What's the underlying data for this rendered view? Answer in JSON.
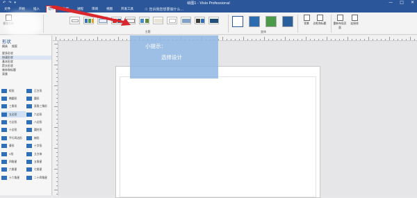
{
  "window": {
    "title": "绘图1 - Visio Professional",
    "qat": [
      "↶",
      "↷",
      "▾"
    ],
    "controls": [
      "—",
      "□",
      "✕"
    ]
  },
  "tabs": [
    {
      "label": "文件",
      "active": false
    },
    {
      "label": "开始",
      "active": false
    },
    {
      "label": "插入",
      "active": false
    },
    {
      "label": "设计",
      "active": true
    },
    {
      "label": "数据",
      "active": false
    },
    {
      "label": "进程",
      "active": false
    },
    {
      "label": "审阅",
      "active": false
    },
    {
      "label": "视图",
      "active": false
    },
    {
      "label": "开发工具",
      "active": false
    }
  ],
  "tellme": "告诉我您想要做什么...",
  "ribbon": {
    "page_setup": {
      "button": "纸张方向"
    },
    "themes_label": "主题",
    "variants_label": "变体",
    "backgrounds": {
      "button1": "背景",
      "button2": "边框和标题"
    },
    "layout": {
      "button1": "重新布局页面",
      "button2": "连接线"
    }
  },
  "shapes_panel": {
    "header": "形状",
    "subtabs": [
      "模具",
      "搜索"
    ],
    "menu": [
      {
        "label": "更多形状",
        "selected": false
      },
      {
        "label": "快速形状",
        "selected": true
      },
      {
        "label": "基本形状",
        "selected": false
      },
      {
        "label": "箭头形状",
        "selected": false
      },
      {
        "label": "装饰和标题",
        "selected": false
      },
      {
        "label": "背景",
        "selected": false
      }
    ],
    "shapes": [
      [
        "矩形",
        "正方形"
      ],
      [
        "椭圆形",
        "圆形"
      ],
      [
        "三角形",
        "直角三角形"
      ],
      [
        "五边形",
        "六边形"
      ],
      [
        "七边形",
        "八边形"
      ],
      [
        "十边形",
        "圆柱形"
      ],
      [
        "平行四边形",
        "梯形"
      ],
      [
        "菱形",
        "十字形"
      ],
      [
        "V形",
        "立方体"
      ],
      [
        "四角星",
        "五角星"
      ],
      [
        "六角星",
        "七角星"
      ],
      [
        "十六角星",
        "二十四角星"
      ]
    ],
    "selected_shape": "五边形"
  },
  "tip": {
    "line1": "小提示：",
    "line2": "选择设计"
  },
  "colors": {
    "accent": "#2b579a",
    "highlight": "#d9272e",
    "tip_bg": "#8fb7e5"
  }
}
